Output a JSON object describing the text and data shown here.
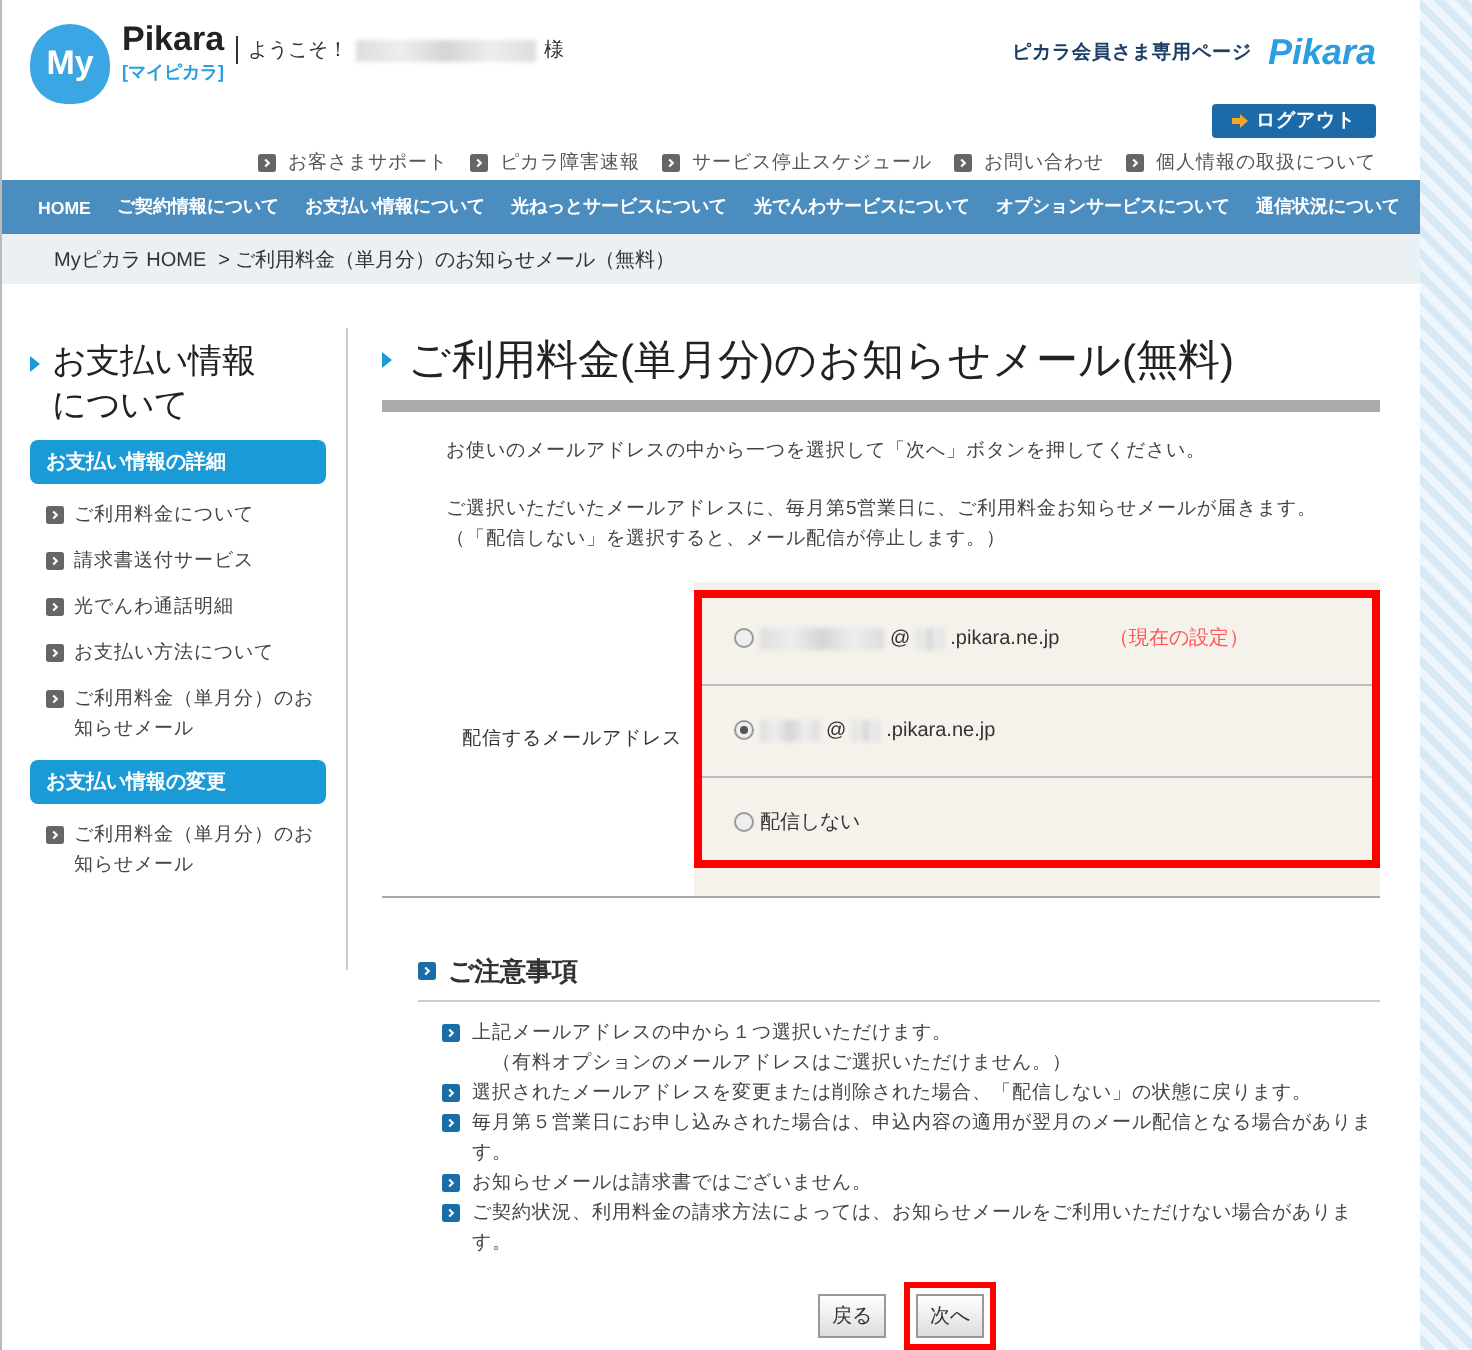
{
  "header": {
    "logo": {
      "mark": "My",
      "name": "Pikara",
      "sub": "[マイピカラ]"
    },
    "welcome": "ようこそ！",
    "honorific": "様",
    "member_page": "ピカラ会員さま専用ページ",
    "brand": "Pikara",
    "logout": "ログアウト",
    "utility_links": [
      "お客さまサポート",
      "ピカラ障害速報",
      "サービス停止スケジュール",
      "お問い合わせ",
      "個人情報の取扱について"
    ]
  },
  "nav": [
    "HOME",
    "ご契約情報について",
    "お支払い情報について",
    "光ねっとサービスについて",
    "光でんわサービスについて",
    "オプションサービスについて",
    "通信状況について"
  ],
  "breadcrumb": {
    "home": "Myピカラ HOME",
    "current": "> ご利用料金（単月分）のお知らせメール（無料）"
  },
  "sidebar": {
    "title": "お支払い情報について",
    "sections": [
      {
        "heading": "お支払い情報の詳細",
        "items": [
          "ご利用料金について",
          "請求書送付サービス",
          "光でんわ通話明細",
          "お支払い方法について",
          "ご利用料金（単月分）のお知らせメール"
        ]
      },
      {
        "heading": "お支払い情報の変更",
        "items": [
          "ご利用料金（単月分）のお知らせメール"
        ]
      }
    ]
  },
  "main": {
    "title": "ご利用料金(単月分)のお知らせメール(無料)",
    "intro": [
      "お使いのメールアドレスの中から一つを選択して「次へ」ボタンを押してください。",
      "ご選択いただいたメールアドレスに、毎月第5営業日に、ご利用料金お知らせメールが届きます。",
      "（「配信しない」を選択すると、メール配信が停止します。）"
    ],
    "form": {
      "label": "配信するメールアドレス",
      "highlighted": true,
      "options": [
        {
          "kind": "email",
          "at": "@",
          "domain": ".pikara.ne.jp",
          "note": "（現在の設定）",
          "selected": false
        },
        {
          "kind": "email",
          "at": "@",
          "domain": ".pikara.ne.jp",
          "selected": true
        },
        {
          "kind": "text",
          "label": "配信しない",
          "selected": false
        }
      ]
    },
    "notes": {
      "heading": "ご注意事項",
      "items": [
        {
          "text": "上記メールアドレスの中から１つ選択いただけます。",
          "sub": "（有料オプションのメールアドレスはご選択いただけません。）"
        },
        {
          "text": "選択されたメールアドレスを変更または削除された場合、「配信しない」の状態に戻ります。"
        },
        {
          "text": "毎月第５営業日にお申し込みされた場合は、申込内容の適用が翌月のメール配信となる場合があります。"
        },
        {
          "text": "お知らせメールは請求書ではございません。"
        },
        {
          "text": "ご契約状況、利用料金の請求方法によっては、お知らせメールをご利用いただけない場合があります。"
        }
      ]
    },
    "buttons": [
      {
        "label": "戻る",
        "highlighted": false
      },
      {
        "label": "次へ",
        "highlighted": true
      }
    ]
  }
}
